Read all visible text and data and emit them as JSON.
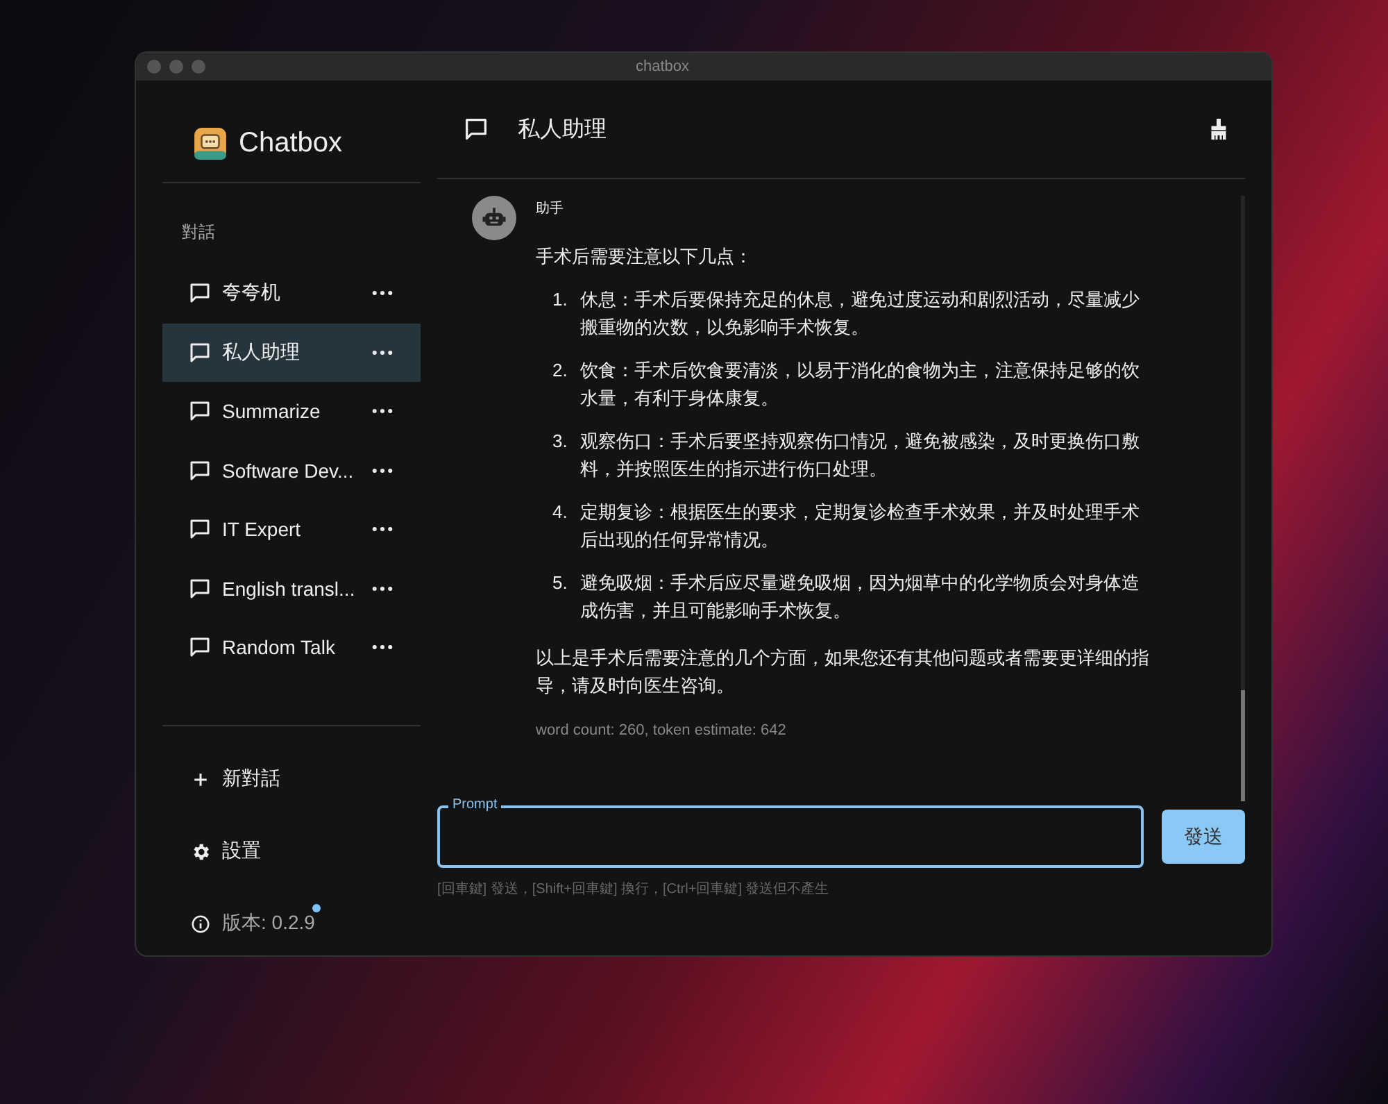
{
  "window": {
    "title": "chatbox"
  },
  "sidebar": {
    "app_name": "Chatbox",
    "section_label": "對話",
    "conversations": [
      {
        "name": "夸夸机",
        "selected": false
      },
      {
        "name": "私人助理",
        "selected": true
      },
      {
        "name": "Summarize",
        "selected": false
      },
      {
        "name": "Software Dev...",
        "selected": false
      },
      {
        "name": "IT Expert",
        "selected": false
      },
      {
        "name": "English transl...",
        "selected": false
      },
      {
        "name": "Random Talk",
        "selected": false
      }
    ],
    "new_chat": "新對話",
    "settings": "設置",
    "version": "版本: 0.2.9",
    "update_available": true
  },
  "header": {
    "title": "私人助理"
  },
  "message": {
    "role": "助手",
    "intro": "手术后需要注意以下几点：",
    "items": [
      {
        "number": "1.",
        "text": "休息：手术后要保持充足的休息，避免过度运动和剧烈活动，尽量减少搬重物的次数，以免影响手术恢复。"
      },
      {
        "number": "2.",
        "text": "饮食：手术后饮食要清淡，以易于消化的食物为主，注意保持足够的饮水量，有利于身体康复。"
      },
      {
        "number": "3.",
        "text": "观察伤口：手术后要坚持观察伤口情况，避免被感染，及时更换伤口敷料，并按照医生的指示进行伤口处理。"
      },
      {
        "number": "4.",
        "text": "定期复诊：根据医生的要求，定期复诊检查手术效果，并及时处理手术后出现的任何异常情况。"
      },
      {
        "number": "5.",
        "text": "避免吸烟：手术后应尽量避免吸烟，因为烟草中的化学物质会对身体造成伤害，并且可能影响手术恢复。"
      }
    ],
    "outro": "以上是手术后需要注意的几个方面，如果您还有其他问题或者需要更详细的指导，请及时向医生咨询。",
    "stats": "word count: 260, token estimate: 642"
  },
  "composer": {
    "label": "Prompt",
    "send": "發送",
    "hint": "[回車鍵] 發送，[Shift+回車鍵] 換行，[Ctrl+回車鍵] 發送但不產生"
  }
}
